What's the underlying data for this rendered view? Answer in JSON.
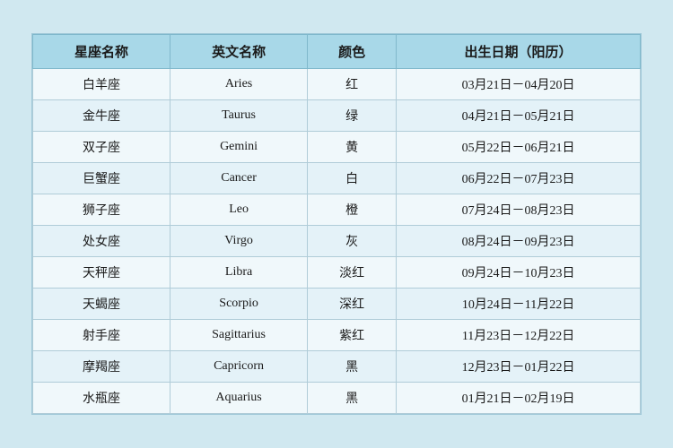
{
  "table": {
    "headers": [
      "星座名称",
      "英文名称",
      "颜色",
      "出生日期（阳历）"
    ],
    "rows": [
      {
        "chinese": "白羊座",
        "english": "Aries",
        "color": "红",
        "dates": "03月21日－04月20日"
      },
      {
        "chinese": "金牛座",
        "english": "Taurus",
        "color": "绿",
        "dates": "04月21日－05月21日"
      },
      {
        "chinese": "双子座",
        "english": "Gemini",
        "color": "黄",
        "dates": "05月22日－06月21日"
      },
      {
        "chinese": "巨蟹座",
        "english": "Cancer",
        "color": "白",
        "dates": "06月22日－07月23日"
      },
      {
        "chinese": "狮子座",
        "english": "Leo",
        "color": "橙",
        "dates": "07月24日－08月23日"
      },
      {
        "chinese": "处女座",
        "english": "Virgo",
        "color": "灰",
        "dates": "08月24日－09月23日"
      },
      {
        "chinese": "天秤座",
        "english": "Libra",
        "color": "淡红",
        "dates": "09月24日－10月23日"
      },
      {
        "chinese": "天蝎座",
        "english": "Scorpio",
        "color": "深红",
        "dates": "10月24日－11月22日"
      },
      {
        "chinese": "射手座",
        "english": "Sagittarius",
        "color": "紫红",
        "dates": "11月23日－12月22日"
      },
      {
        "chinese": "摩羯座",
        "english": "Capricorn",
        "color": "黑",
        "dates": "12月23日－01月22日"
      },
      {
        "chinese": "水瓶座",
        "english": "Aquarius",
        "color": "黑",
        "dates": "01月21日－02月19日"
      }
    ]
  }
}
